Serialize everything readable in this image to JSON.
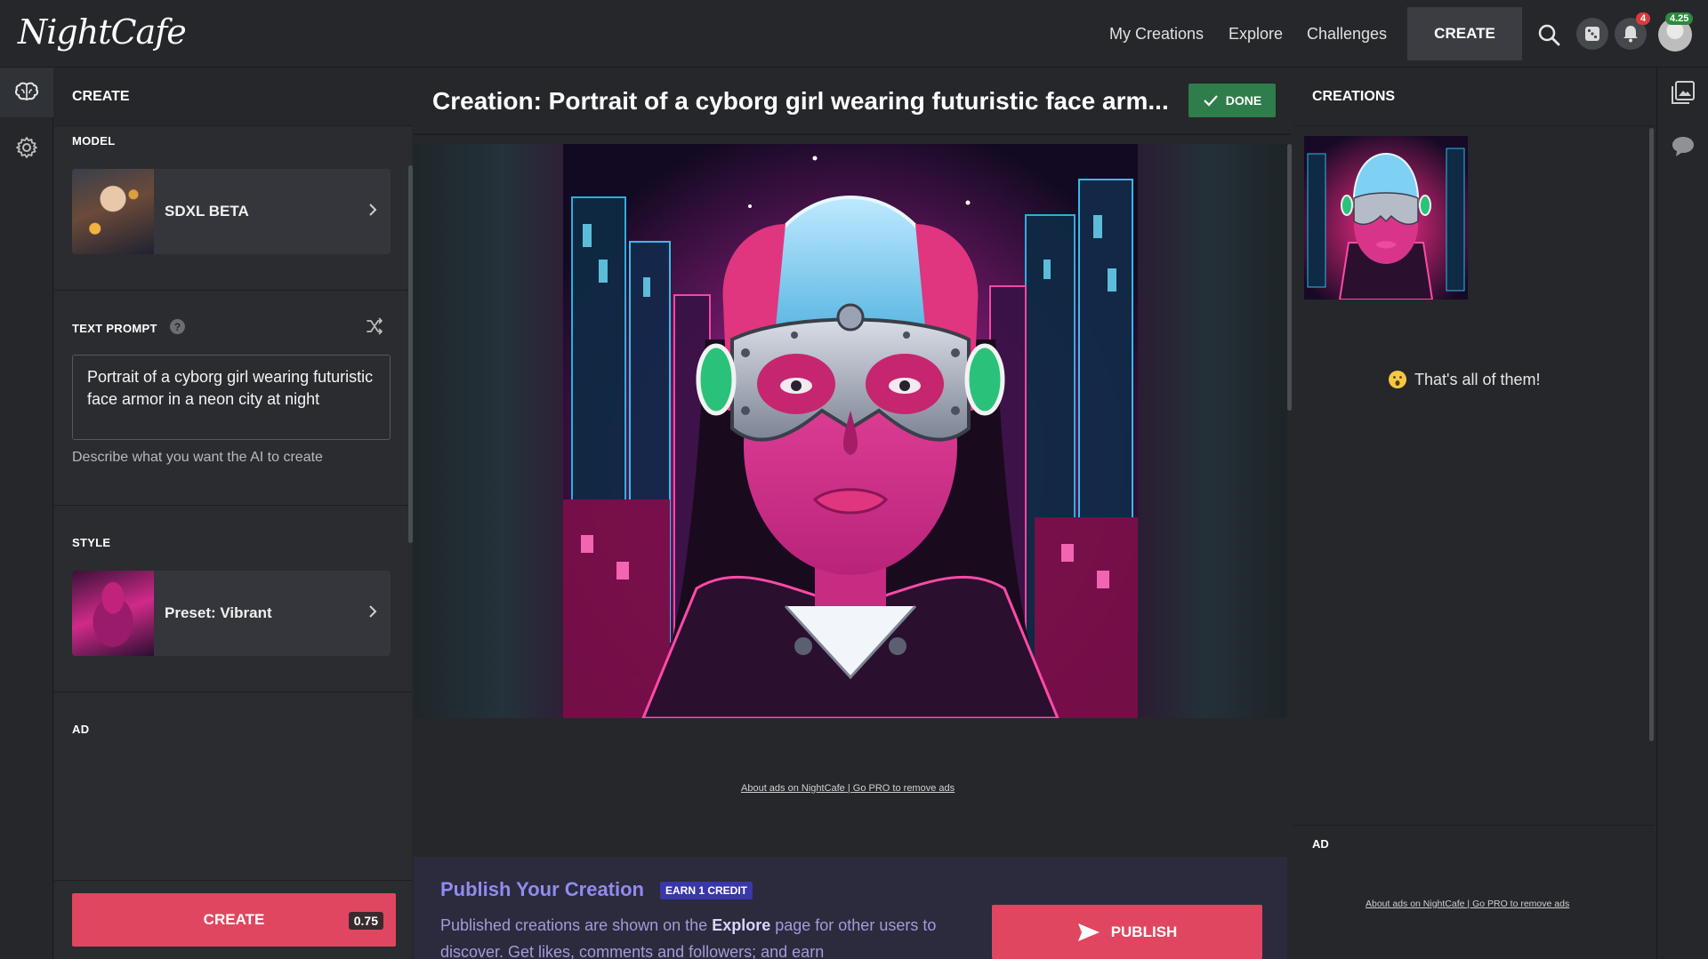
{
  "app": {
    "logo": "NightCafe"
  },
  "nav": {
    "links": [
      "My Creations",
      "Explore",
      "Challenges"
    ],
    "create_label": "CREATE",
    "notifications_count": "4",
    "credits": "4.25"
  },
  "left_panel": {
    "header": "CREATE",
    "model": {
      "section_title": "MODEL",
      "value": "SDXL BETA"
    },
    "prompt": {
      "section_title": "TEXT PROMPT",
      "help_icon": "?",
      "value": "Portrait of a cyborg girl wearing futuristic face armor in a neon city at night",
      "help": "Describe what you want the AI to create"
    },
    "style": {
      "section_title": "STYLE",
      "value": "Preset: Vibrant"
    },
    "ad_label": "AD",
    "create_button": "CREATE",
    "create_cost": "0.75"
  },
  "center": {
    "title": "Creation: Portrait of a cyborg girl wearing futuristic face arm...",
    "status": "DONE",
    "ads_about": "About ads on NightCafe",
    "ads_sep": " | ",
    "ads_pro": "Go PRO to remove ads",
    "publish": {
      "title": "Publish Your Creation",
      "badge": "EARN 1 CREDIT",
      "desc_pre": "Published creations are shown on the ",
      "desc_link": "Explore",
      "desc_post": " page for other users to discover. Get likes, comments and followers; and earn",
      "button": "PUBLISH"
    }
  },
  "right_panel": {
    "header": "CREATIONS",
    "end_message": "That's all of them!",
    "ad_label": "AD",
    "ads_about": "About ads on NightCafe",
    "ads_sep": " | ",
    "ads_pro": "Go PRO to remove ads"
  },
  "icons": {
    "rail": [
      "brain-icon",
      "gear-icon"
    ],
    "top": [
      "search-icon",
      "dice-icon",
      "bell-icon",
      "avatar"
    ],
    "right_rail": [
      "gallery-icon",
      "chat-icon"
    ]
  },
  "colors": {
    "accent_red": "#e0465f",
    "done_green": "#2e7d4a",
    "publish_purple": "#8f8cf0",
    "background": "#25272b"
  }
}
